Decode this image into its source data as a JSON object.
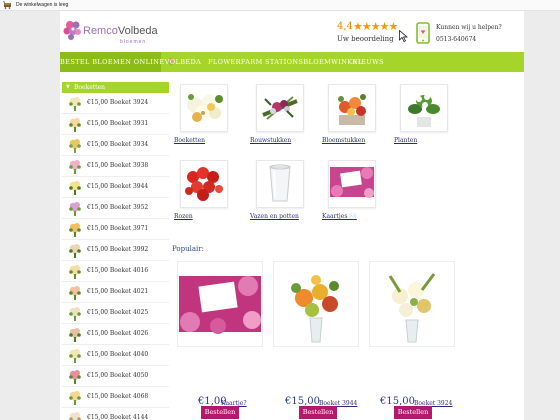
{
  "cart": {
    "text": "De winkelwagen is leeg"
  },
  "logo": {
    "first": "Remco",
    "last": "Volbeda",
    "sub": "bloemen"
  },
  "rating": {
    "score": "4,4",
    "stars": "★★★★★",
    "label": "Uw beoordeling",
    "value": 4.4
  },
  "help": {
    "line1": "Kunnen wij u helpen?",
    "line2": "0513-640674"
  },
  "nav": [
    {
      "label": "BESTEL BLOEMEN ONLINE 🌷"
    },
    {
      "label": "VOLBEDA"
    },
    {
      "label": "FLOWERFARM"
    },
    {
      "label": "STATIONSBLOEMWINKEL"
    },
    {
      "label": "NIEUWS"
    }
  ],
  "sidebar": {
    "heading": "Boeketten",
    "items": [
      {
        "label": "€15,00 Boeket 3924"
      },
      {
        "label": "€15,00 Boeket 3931"
      },
      {
        "label": "€15,00 Boeket 3934"
      },
      {
        "label": "€15,00 Boeket 3938"
      },
      {
        "label": "€15,00 Boeket 3944"
      },
      {
        "label": "€15,00 Boeket 3952"
      },
      {
        "label": "€15,00 Boeket 3971"
      },
      {
        "label": "€15,00 Boeket 3992"
      },
      {
        "label": "€15,00 Boeket 4016"
      },
      {
        "label": "€15,00 Boeket 4021"
      },
      {
        "label": "€15,00 Boeket 4025"
      },
      {
        "label": "€15,00 Boeket 4026"
      },
      {
        "label": "€15,00 Boeket 4040"
      },
      {
        "label": "€15,00 Boeket 4050"
      },
      {
        "label": "€15,00 Boeket 4068"
      },
      {
        "label": "€15,00 Boeket 4144"
      }
    ]
  },
  "categories": [
    {
      "label": "Boeketten"
    },
    {
      "label": "Rouwstukken"
    },
    {
      "label": "Bloemstukken"
    },
    {
      "label": "Planten"
    },
    {
      "label": "Rozen"
    },
    {
      "label": "Vazen en potten"
    },
    {
      "label": "Kaartjes ✉️"
    }
  ],
  "popular": {
    "title": "Populair:",
    "products": [
      {
        "price": "€1,00",
        "name": "Kaartje?",
        "button": "Bestellen"
      },
      {
        "price": "€15,00",
        "name": "Boeket 3944",
        "button": "Bestellen"
      },
      {
        "price": "€15,00",
        "name": "Boeket 3924",
        "button": "Bestellen"
      }
    ]
  },
  "colors": {
    "accent_green": "#a5d52a",
    "button_magenta": "#b5196e",
    "brand_purple": "#9b6fb8"
  }
}
